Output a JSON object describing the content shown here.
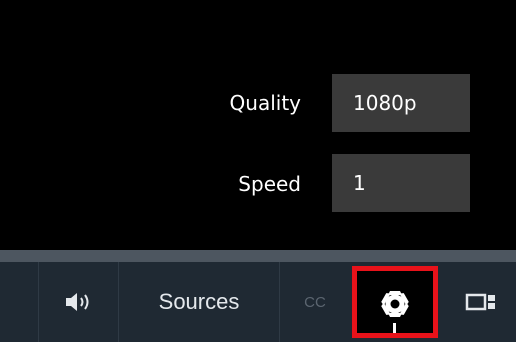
{
  "settings_menu": {
    "quality": {
      "label": "Quality",
      "value": "1080p"
    },
    "speed": {
      "label": "Speed",
      "value": "1"
    }
  },
  "control_bar": {
    "volume": {
      "icon": "volume-icon"
    },
    "sources": {
      "label": "Sources"
    },
    "captions": {
      "label": "CC"
    },
    "settings": {
      "icon": "gear-icon",
      "highlighted": true
    },
    "layout": {
      "icon": "picture-in-picture-icon"
    }
  },
  "colors": {
    "control_bar_bg": "#1f2933",
    "progress_track": "#4d5660",
    "menu_value_bg": "#3a3a3a",
    "highlight": "#e8121a"
  }
}
